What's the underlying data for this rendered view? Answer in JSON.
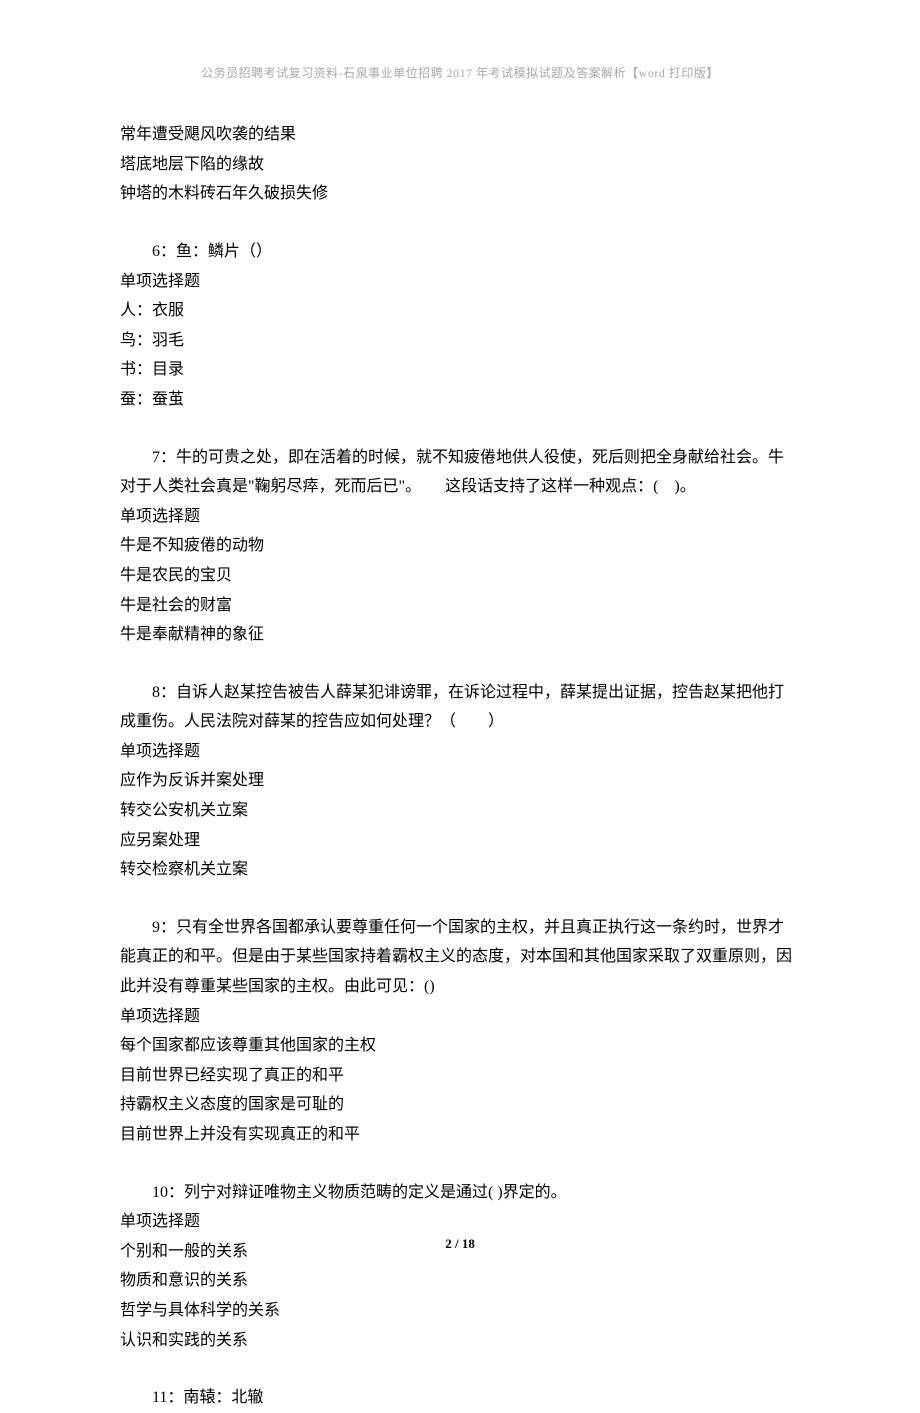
{
  "header": {
    "text_a": "公务员招聘考试复习资料-石泉事业单位招聘 2017 年考试模拟试题及答案解析【",
    "text_b": "word",
    "text_c": " 打印版】"
  },
  "questions": [
    {
      "prefix_options": [
        "常年遭受飓风吹袭的结果",
        "塔底地层下陷的缘故",
        "钟塔的木料砖石年久破损失修"
      ]
    },
    {
      "num": "6：",
      "stem": "鱼：鳞片（）",
      "type": "单项选择题",
      "options": [
        "人：衣服",
        "鸟：羽毛",
        "书：目录",
        "蚕：蚕茧"
      ]
    },
    {
      "num": "7：",
      "stem": "牛的可贵之处，即在活着的时候，就不知疲倦地供人役使，死后则把全身献给社会。牛对于人类社会真是\"鞠躬尽瘁，死而后已\"。　　这段话支持了这样一种观点：(　)。",
      "type": "单项选择题",
      "options": [
        "牛是不知疲倦的动物",
        "牛是农民的宝贝",
        "牛是社会的财富",
        "牛是奉献精神的象征"
      ]
    },
    {
      "num": "8：",
      "stem": "自诉人赵某控告被告人薛某犯诽谤罪，在诉论过程中，薛某提出证据，控告赵某把他打成重伤。人民法院对薛某的控告应如何处理？（　　）",
      "type": "单项选择题",
      "options": [
        "应作为反诉并案处理",
        "转交公安机关立案",
        "应另案处理",
        "转交检察机关立案"
      ]
    },
    {
      "num": "9：",
      "stem": "只有全世界各国都承认要尊重任何一个国家的主权，并且真正执行这一条约时，世界才能真正的和平。但是由于某些国家持着霸权主义的态度，对本国和其他国家采取了双重原则，因此并没有尊重某些国家的主权。由此可见：()",
      "type": "单项选择题",
      "options": [
        "每个国家都应该尊重其他国家的主权",
        "目前世界已经实现了真正的和平",
        "持霸权主义态度的国家是可耻的",
        "目前世界上并没有实现真正的和平"
      ]
    },
    {
      "num": "10：",
      "stem": "列宁对辩证唯物主义物质范畴的定义是通过( )界定的。",
      "type": "单项选择题",
      "options": [
        "个别和一般的关系",
        "物质和意识的关系",
        "哲学与具体科学的关系",
        "认识和实践的关系"
      ]
    },
    {
      "num": "11：",
      "stem": "南辕：北辙",
      "type": "",
      "options": []
    }
  ],
  "footer": {
    "page": "2",
    "sep": " / ",
    "total": "18"
  }
}
